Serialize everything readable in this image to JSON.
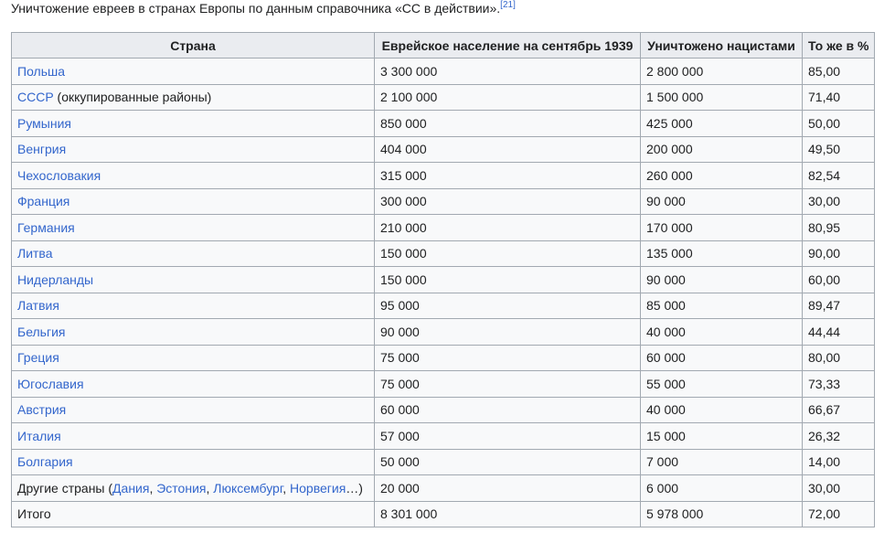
{
  "caption": {
    "text": "Уничтожение евреев в странах Европы по данным справочника «СС в действии».",
    "ref": "[21]"
  },
  "table": {
    "headers": [
      "Страна",
      "Еврейское население на сентябрь 1939",
      "Уничтожено нацистами",
      "То же в %"
    ],
    "rows": [
      {
        "country": "Польша",
        "population": "3 300 000",
        "killed": "2 800 000",
        "percent": "85,00"
      },
      {
        "country": "СССР",
        "country_note": " (оккупированные районы)",
        "population": "2 100 000",
        "killed": "1 500 000",
        "percent": "71,40"
      },
      {
        "country": "Румыния",
        "population": "850 000",
        "killed": "425 000",
        "percent": "50,00"
      },
      {
        "country": "Венгрия",
        "population": "404 000",
        "killed": "200 000",
        "percent": "49,50"
      },
      {
        "country": "Чехословакия",
        "population": "315 000",
        "killed": "260 000",
        "percent": "82,54"
      },
      {
        "country": "Франция",
        "population": "300 000",
        "killed": "90 000",
        "percent": "30,00"
      },
      {
        "country": "Германия",
        "population": "210 000",
        "killed": "170 000",
        "percent": "80,95"
      },
      {
        "country": "Литва",
        "population": "150 000",
        "killed": "135 000",
        "percent": "90,00"
      },
      {
        "country": "Нидерланды",
        "population": "150 000",
        "killed": "90 000",
        "percent": "60,00"
      },
      {
        "country": "Латвия",
        "population": "95 000",
        "killed": "85 000",
        "percent": "89,47"
      },
      {
        "country": "Бельгия",
        "population": "90 000",
        "killed": "40 000",
        "percent": "44,44"
      },
      {
        "country": "Греция",
        "population": "75 000",
        "killed": "60 000",
        "percent": "80,00"
      },
      {
        "country": "Югославия",
        "population": "75 000",
        "killed": "55 000",
        "percent": "73,33"
      },
      {
        "country": "Австрия",
        "population": "60 000",
        "killed": "40 000",
        "percent": "66,67"
      },
      {
        "country": "Италия",
        "population": "57 000",
        "killed": "15 000",
        "percent": "26,32"
      },
      {
        "country": "Болгария",
        "population": "50 000",
        "killed": "7 000",
        "percent": "14,00"
      }
    ],
    "other": {
      "prefix": "Другие страны (",
      "links": [
        "Дания",
        "Эстония",
        "Люксембург",
        "Норвегия"
      ],
      "sep": ", ",
      "suffix": "…)",
      "population": "20 000",
      "killed": "6 000",
      "percent": "30,00"
    },
    "total": {
      "label": "Итого",
      "population": "8 301 000",
      "killed": "5 978 000",
      "percent": "72,00"
    }
  },
  "colors": {
    "link": "#3366cc",
    "text": "#202122",
    "border": "#a2a9b1",
    "header_bg": "#eaecf0",
    "cell_bg": "#f8f9fa"
  }
}
